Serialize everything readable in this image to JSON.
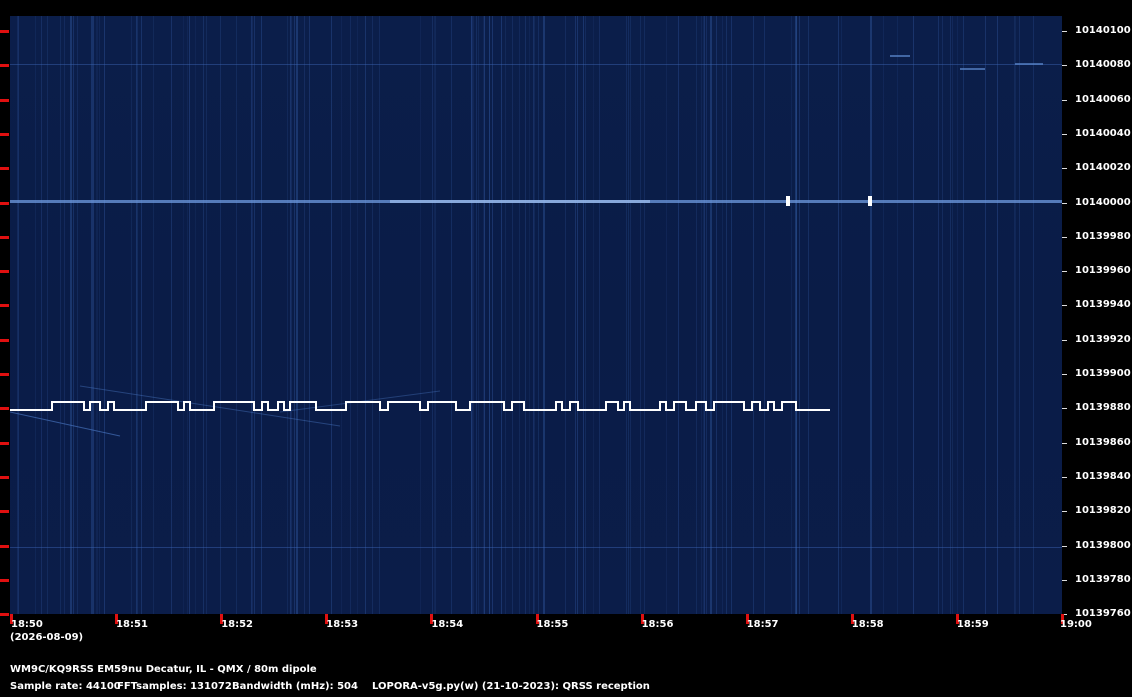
{
  "spectrogram": {
    "y_labels": [
      "10140100",
      "10140080",
      "10140060",
      "10140040",
      "10140020",
      "10140000",
      "10139980",
      "10139960",
      "10139940",
      "10139920",
      "10139900",
      "10139880",
      "10139860",
      "10139840",
      "10139820",
      "10139800",
      "10139780",
      "10139760"
    ],
    "x_labels": [
      "18:50",
      "18:51",
      "18:52",
      "18:53",
      "18:54",
      "18:55",
      "18:56",
      "18:57",
      "18:58",
      "18:59",
      "19:00"
    ],
    "date": "(2026-08-09)"
  },
  "footer": {
    "station": "WM9C/KQ9RSS EM59nu Decatur, IL - QMX / 80m dipole",
    "sample_rate": "Sample rate: 44100",
    "fft_samples": "FFTsamples: 131072",
    "bandwidth": "Bandwidth (mHz): 504",
    "software": "LOPORA-v5g.py(w) (21-10-2023): QRSS reception"
  },
  "colors": {
    "background": "#0b1d49",
    "tick": "#e01010",
    "signal": "#ffffff"
  }
}
